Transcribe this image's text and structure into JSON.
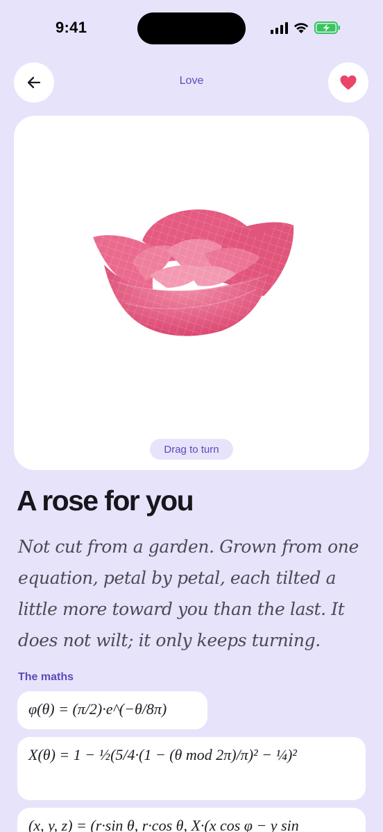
{
  "status_bar": {
    "time": "9:41",
    "icons": [
      "cellular-signal-icon",
      "wifi-icon",
      "battery-charging-icon"
    ],
    "battery_color": "#34c759"
  },
  "header": {
    "title": "Love",
    "back_icon": "arrow-left-icon",
    "favorite_icon": "heart-icon",
    "favorite_color": "#e94568"
  },
  "viewer": {
    "hint": "Drag to turn",
    "model_color": "#e2587c"
  },
  "content": {
    "title": "A rose for you",
    "body": "Not cut from a garden. Grown from one equation, petal by petal, each tilted a little more toward you than the last. It does not wilt; it only keeps turning.",
    "maths_label": "The maths",
    "equations": [
      "φ(θ) = (π/2)·e^(−θ/8π)",
      "X(θ) = 1 − ½(5/4·(1 − (θ mod 2π)/π)² − ¼)²",
      "(x, y, z) = (r·sin θ, r·cos θ, X·(x cos φ − y sin"
    ]
  },
  "colors": {
    "background": "#e7e3fb",
    "accent": "#5a4bb8",
    "card": "#ffffff"
  }
}
